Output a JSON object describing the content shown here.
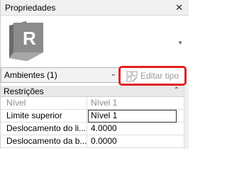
{
  "panel": {
    "title": "Propriedades",
    "close_glyph": "✕"
  },
  "preview": {
    "logo_letter": "R",
    "dropdown_glyph": "▼"
  },
  "type_selector": {
    "label": "Ambientes (1)",
    "chevron": "⌄"
  },
  "edit_type": {
    "label": "Editar tipo",
    "icon": "edit-type-icon",
    "highlight_color": "#e02020"
  },
  "section": {
    "label": "Restrições",
    "collapse_glyph": "⌃"
  },
  "rows": [
    {
      "name": "Nível",
      "value": "Nível 1"
    },
    {
      "name": "Limite superior",
      "value": "Nível 1"
    },
    {
      "name": "Deslocamento do li...",
      "value": "4.0000"
    },
    {
      "name": "Deslocamento da b...",
      "value": "0.0000"
    }
  ]
}
